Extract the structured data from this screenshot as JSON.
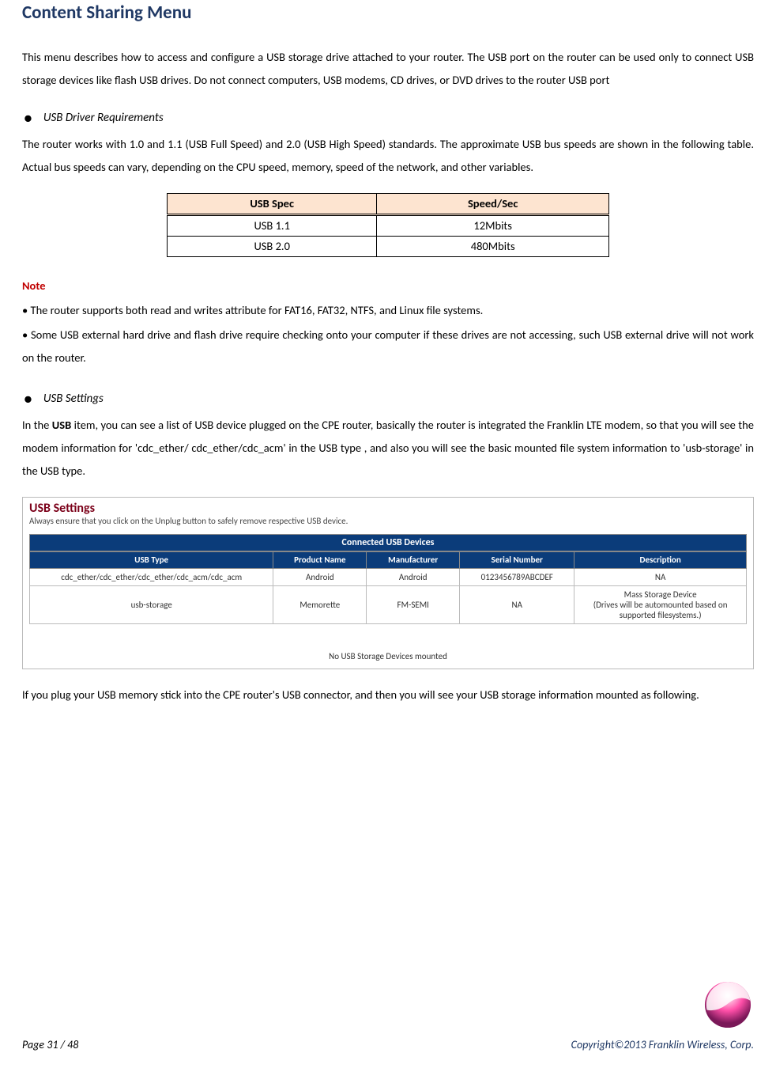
{
  "title": "Content Sharing Menu",
  "intro": "This menu describes how to access and configure a USB storage drive attached to your router. The USB port on the router can be used only to connect USB storage devices like flash USB drives. Do not connect computers, USB modems, CD drives, or DVD drives to the router USB port",
  "sec1": {
    "heading": "USB Driver Requirements",
    "body": "The router works with 1.0 and 1.1 (USB Full Speed) and 2.0 (USB High Speed) standards. The approximate USB bus speeds are shown in the following table. Actual bus speeds can vary, depending on the CPU speed, memory, speed of the network, and other variables."
  },
  "spec_table": {
    "headers": [
      "USB Spec",
      "Speed/Sec"
    ],
    "rows": [
      [
        "USB 1.1",
        "12Mbits"
      ],
      [
        "USB 2.0",
        "480Mbits"
      ]
    ]
  },
  "note": {
    "label": "Note",
    "items": [
      "• The router supports both read and writes attribute for FAT16, FAT32, NTFS, and Linux file systems.",
      "• Some USB external hard drive and flash drive require checking onto your computer if these drives are not accessing, such USB external drive will not work on the router."
    ]
  },
  "sec2": {
    "heading": "USB Settings",
    "body_pre": "In the ",
    "body_bold": "USB",
    "body_post": " item, you can see a list of USB device plugged on the CPE router, basically the router is integrated the Franklin LTE modem, so that you will see the modem information for 'cdc_ether/ cdc_ether/cdc_acm' in the USB type , and also you will see the basic mounted file system information to 'usb-storage' in the USB type."
  },
  "shot": {
    "title": "USB Settings",
    "sub": "Always ensure that you click on the Unplug button to safely remove respective USB device.",
    "bar": "Connected USB Devices",
    "headers": [
      "USB Type",
      "Product Name",
      "Manufacturer",
      "Serial Number",
      "Description"
    ],
    "rows": [
      [
        "cdc_ether/cdc_ether/cdc_ether/cdc_acm/cdc_acm",
        "Android",
        "Android",
        "0123456789ABCDEF",
        "NA"
      ],
      [
        "usb-storage",
        "Memorette",
        "FM-SEMI",
        "NA",
        "Mass Storage Device\n(Drives will be automounted based on supported filesystems.)"
      ]
    ],
    "no_mount": "No USB Storage Devices mounted"
  },
  "post_shot": "If you plug your USB memory stick into the CPE router's USB connector, and then you will see your USB storage information mounted as following.",
  "footer": {
    "left": "Page  31  /  48",
    "right": "Copyright©2013  Franklin  Wireless, Corp."
  }
}
